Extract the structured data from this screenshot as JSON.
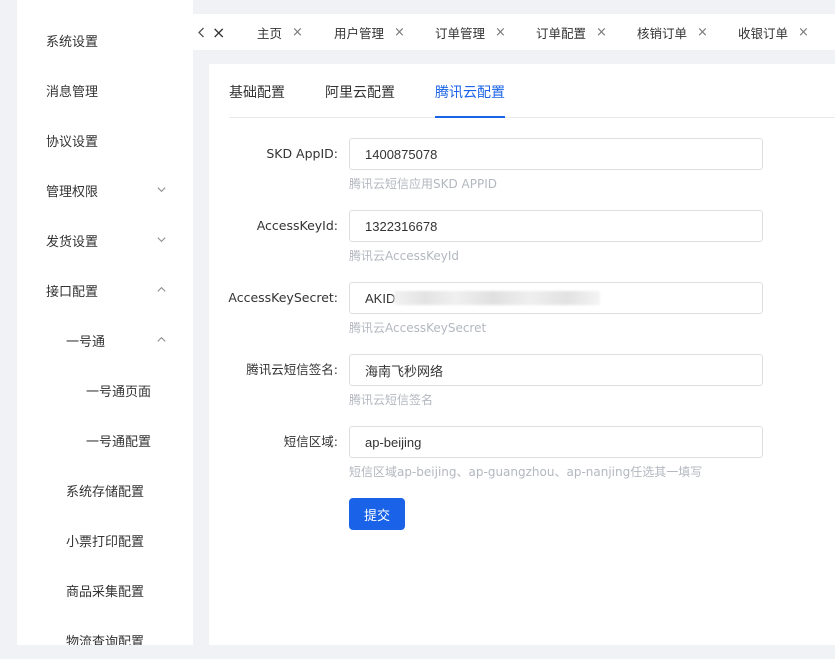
{
  "sidebar": {
    "items": [
      {
        "label": "系统设置"
      },
      {
        "label": "消息管理"
      },
      {
        "label": "协议设置"
      },
      {
        "label": "管理权限",
        "chevron": "chevron-down-icon"
      },
      {
        "label": "发货设置",
        "chevron": "chevron-down-icon"
      },
      {
        "label": "接口配置",
        "chevron": "chevron-up-icon"
      },
      {
        "label": "一号通",
        "chevron": "chevron-up-icon"
      },
      {
        "label": "一号通页面"
      },
      {
        "label": "一号通配置"
      },
      {
        "label": "系统存储配置"
      },
      {
        "label": "小票打印配置"
      },
      {
        "label": "商品采集配置"
      },
      {
        "label": "物流查询配置"
      }
    ]
  },
  "tabs": {
    "prev_icon": "chevron-left-icon",
    "close_glyph": "×",
    "items": [
      {
        "label": "主页"
      },
      {
        "label": "用户管理"
      },
      {
        "label": "订单管理"
      },
      {
        "label": "订单配置"
      },
      {
        "label": "核销订单"
      },
      {
        "label": "收银订单"
      }
    ]
  },
  "config": {
    "subtabs": [
      {
        "label": "基础配置"
      },
      {
        "label": "阿里云配置"
      },
      {
        "label": "腾讯云配置",
        "active": true
      }
    ],
    "fields": [
      {
        "label": "SKD AppID:",
        "value": "1400875078",
        "hint": "腾讯云短信应用SKD APPID"
      },
      {
        "label": "AccessKeyId:",
        "value": "1322316678",
        "hint": "腾讯云AccessKeyId"
      },
      {
        "label": "AccessKeySecret:",
        "value": "AKID",
        "hint": "腾讯云AccessKeySecret"
      },
      {
        "label": "腾讯云短信签名:",
        "value": "海南飞秒网络",
        "hint": "腾讯云短信签名"
      },
      {
        "label": "短信区域:",
        "value": "ap-beijing",
        "hint": "短信区域ap-beijing、ap-guangzhou、ap-nanjing任选其一填写"
      }
    ],
    "submit_label": "提交"
  },
  "colors": {
    "accent": "#1a63e8",
    "background": "#f0f2f5",
    "hint_text": "#b3b7bf"
  }
}
